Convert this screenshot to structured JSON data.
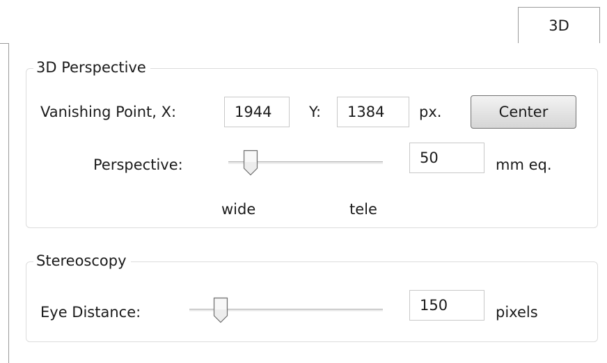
{
  "tab": {
    "label": "3D"
  },
  "perspective_group": {
    "title": "3D Perspective",
    "vanishing_x_label": "Vanishing Point, X:",
    "vanishing_x_value": "1944",
    "vanishing_y_label": "Y:",
    "vanishing_y_value": "1384",
    "px_unit": "px.",
    "center_button": "Center",
    "perspective_label": "Perspective:",
    "perspective_slider_level": 0.1,
    "perspective_value": "50",
    "perspective_unit": "mm eq.",
    "wide_label": "wide",
    "tele_label": "tele"
  },
  "stereoscopy_group": {
    "title": "Stereoscopy",
    "eye_distance_label": "Eye Distance:",
    "eye_distance_slider_level": 0.13,
    "eye_distance_value": "150",
    "eye_distance_unit": "pixels"
  }
}
